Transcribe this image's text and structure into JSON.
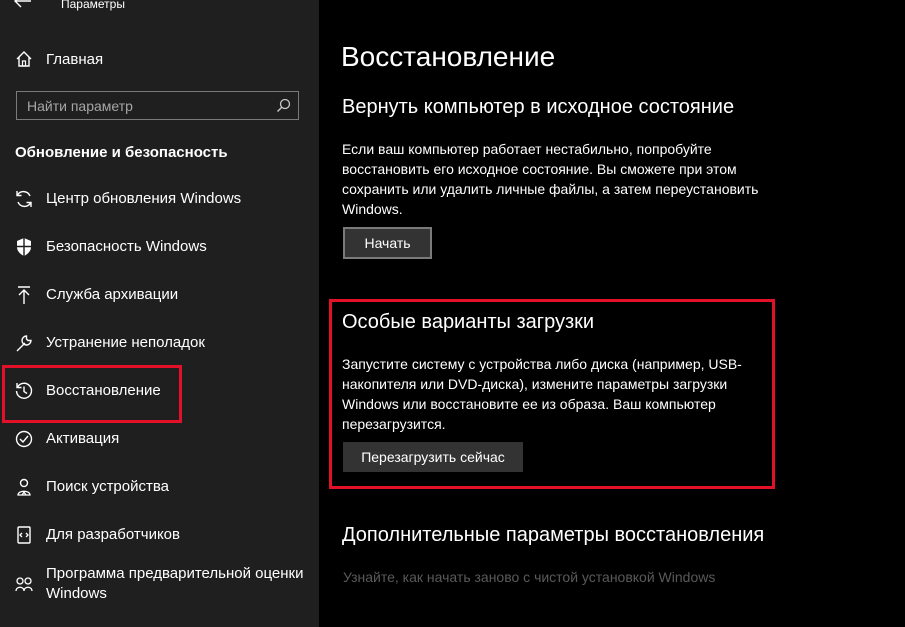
{
  "app": {
    "title": "Параметры"
  },
  "sidebar": {
    "home_label": "Главная",
    "search_placeholder": "Найти параметр",
    "section_header": "Обновление и безопасность",
    "items": [
      {
        "label": "Центр обновления Windows",
        "icon": "sync-icon"
      },
      {
        "label": "Безопасность Windows",
        "icon": "shield-icon"
      },
      {
        "label": "Служба архивации",
        "icon": "backup-arrow-icon"
      },
      {
        "label": "Устранение неполадок",
        "icon": "wrench-icon"
      },
      {
        "label": "Восстановление",
        "icon": "recovery-icon",
        "selected": true
      },
      {
        "label": "Активация",
        "icon": "check-circle-icon"
      },
      {
        "label": "Поиск устройства",
        "icon": "person-location-icon"
      },
      {
        "label": "Для разработчиков",
        "icon": "developer-icon"
      },
      {
        "label": "Программа предварительной оценки Windows",
        "icon": "insider-icon"
      }
    ]
  },
  "main": {
    "title": "Восстановление",
    "reset": {
      "heading": "Вернуть компьютер в исходное состояние",
      "description": "Если ваш компьютер работает нестабильно, попробуйте восстановить его исходное состояние. Вы сможете при этом сохранить или удалить личные файлы, а затем переустановить Windows.",
      "button": "Начать"
    },
    "advanced_startup": {
      "heading": "Особые варианты загрузки",
      "description": "Запустите систему с устройства либо диска (например, USB-накопителя или DVD-диска), измените параметры загрузки Windows или восстановите ее из образа. Ваш компьютер перезагрузится.",
      "button": "Перезагрузить сейчас"
    },
    "more_options": {
      "heading": "Дополнительные параметры восстановления",
      "link": "Узнайте, как начать заново с чистой установкой Windows"
    }
  },
  "colors": {
    "highlight": "#e3102a",
    "sidebar_bg": "#1f1f1f",
    "main_bg": "#000000"
  }
}
